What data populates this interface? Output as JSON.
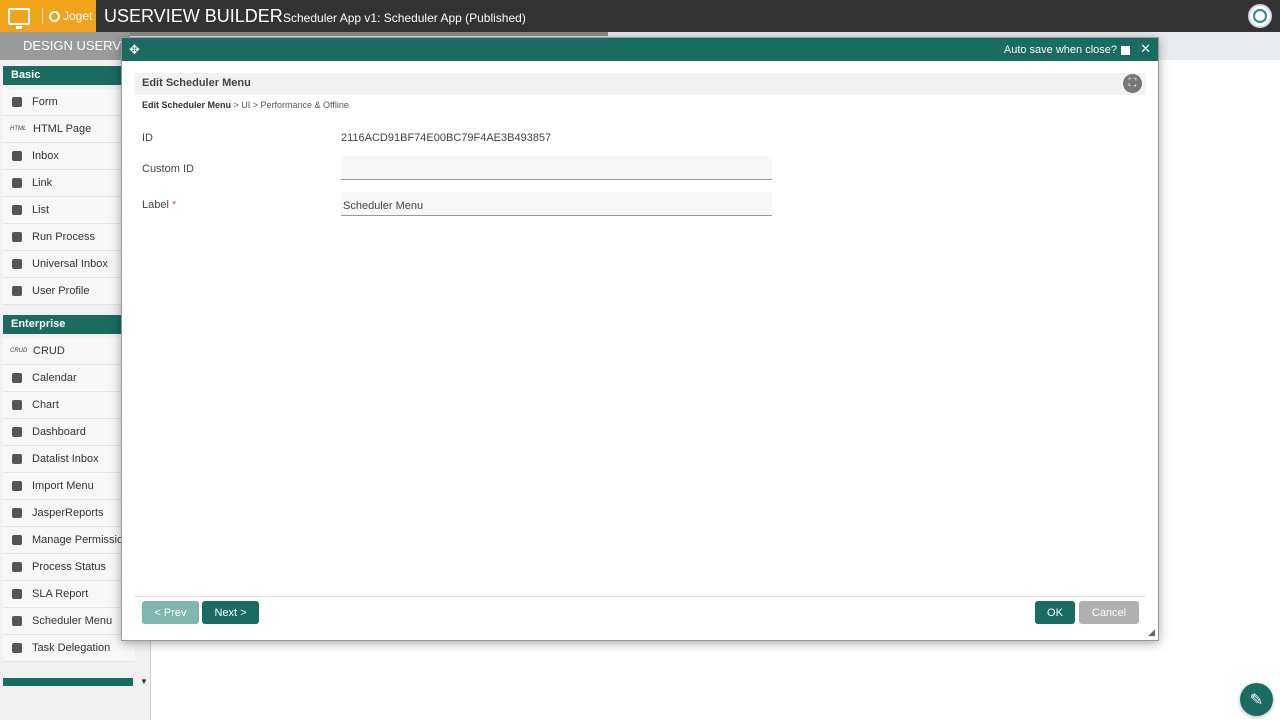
{
  "topbar": {
    "brand_label": "Joget",
    "title": "USERVIEW BUILDER",
    "subtitle": "Scheduler App v1: Scheduler App (Published)"
  },
  "subbar": {
    "design_tab": "DESIGN USERVIEW"
  },
  "sidebar": {
    "basic_header": "Basic",
    "basic_items": [
      {
        "label": "Form",
        "icon": "form-icon"
      },
      {
        "label": "HTML Page",
        "icon": "html-icon",
        "icon_text": "HTML"
      },
      {
        "label": "Inbox",
        "icon": "inbox-icon"
      },
      {
        "label": "Link",
        "icon": "link-icon"
      },
      {
        "label": "List",
        "icon": "list-icon"
      },
      {
        "label": "Run Process",
        "icon": "play-icon"
      },
      {
        "label": "Universal Inbox",
        "icon": "inbox-icon"
      },
      {
        "label": "User Profile",
        "icon": "user-icon"
      }
    ],
    "enterprise_header": "Enterprise",
    "enterprise_items": [
      {
        "label": "CRUD",
        "icon": "crud-icon",
        "icon_text": "CRUD"
      },
      {
        "label": "Calendar",
        "icon": "calendar-icon"
      },
      {
        "label": "Chart",
        "icon": "chart-icon"
      },
      {
        "label": "Dashboard",
        "icon": "dashboard-icon"
      },
      {
        "label": "Datalist Inbox",
        "icon": "inbox-icon"
      },
      {
        "label": "Import Menu",
        "icon": "import-icon"
      },
      {
        "label": "JasperReports",
        "icon": "report-icon"
      },
      {
        "label": "Manage Permission",
        "icon": "users-icon"
      },
      {
        "label": "Process Status",
        "icon": "status-icon"
      },
      {
        "label": "SLA Report",
        "icon": "sla-icon"
      },
      {
        "label": "Scheduler Menu",
        "icon": "scheduler-icon"
      },
      {
        "label": "Task Delegation",
        "icon": "delegation-icon"
      }
    ]
  },
  "dialog": {
    "autosave_label": "Auto save when close?",
    "header_title": "Edit Scheduler Menu",
    "breadcrumb": {
      "current": "Edit Scheduler Menu",
      "rest": " > UI > Performance & Offline"
    },
    "fields": {
      "id_label": "ID",
      "id_value": "2116ACD91BF74E00BC79F4AE3B493857",
      "custom_id_label": "Custom ID",
      "custom_id_value": "",
      "label_label": "Label",
      "label_required": "*",
      "label_value": "Scheduler Menu"
    },
    "buttons": {
      "prev": "< Prev",
      "next": "Next >",
      "ok": "OK",
      "cancel": "Cancel"
    }
  }
}
